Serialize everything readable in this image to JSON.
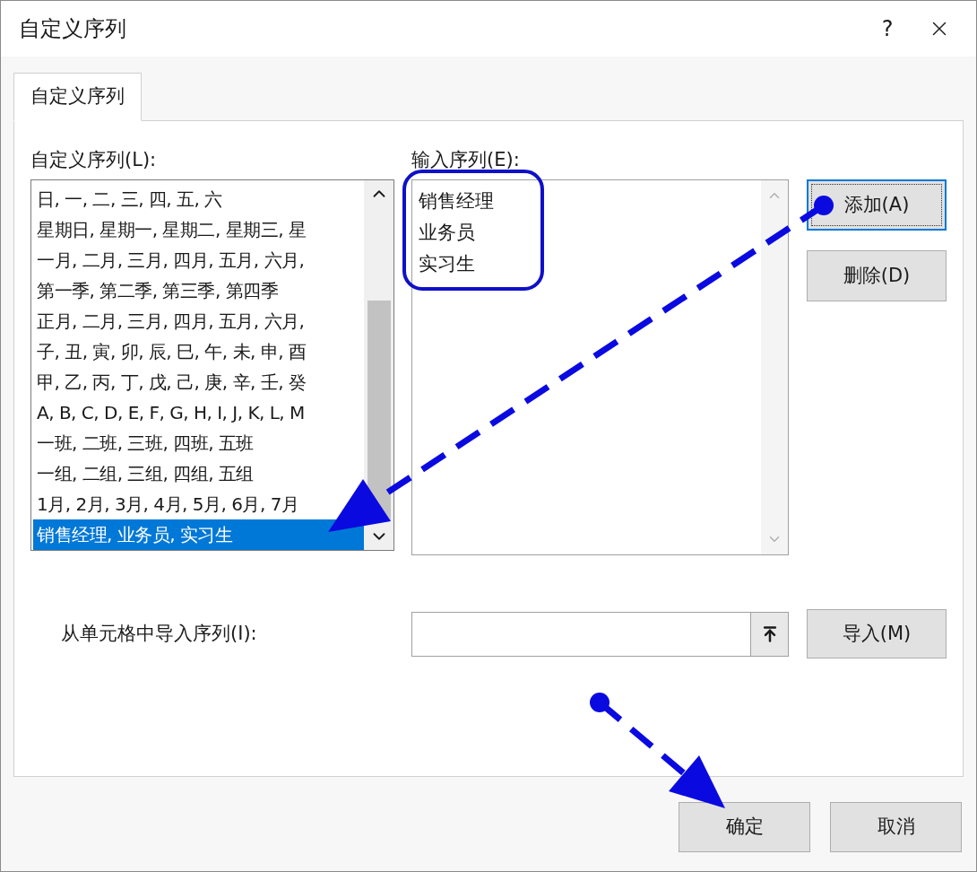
{
  "window": {
    "title": "自定义序列",
    "help": "?"
  },
  "tabs": [
    {
      "label": "自定义序列",
      "selected": true
    }
  ],
  "custom_lists": {
    "label": "自定义序列(L):",
    "items": [
      {
        "text": "日, 一, 二, 三, 四, 五, 六",
        "selected": false
      },
      {
        "text": "星期日, 星期一, 星期二, 星期三, 星",
        "selected": false
      },
      {
        "text": "一月, 二月, 三月, 四月, 五月, 六月,",
        "selected": false
      },
      {
        "text": "第一季, 第二季, 第三季, 第四季",
        "selected": false
      },
      {
        "text": "正月, 二月, 三月, 四月, 五月, 六月,",
        "selected": false
      },
      {
        "text": "子, 丑, 寅, 卯, 辰, 巳, 午, 未, 申, 酉",
        "selected": false
      },
      {
        "text": "甲, 乙, 丙, 丁, 戊, 己, 庚, 辛, 壬, 癸",
        "selected": false
      },
      {
        "text": "A, B, C, D, E, F, G, H, I, J, K, L, M",
        "selected": false
      },
      {
        "text": "一班, 二班, 三班, 四班, 五班",
        "selected": false
      },
      {
        "text": "一组, 二组, 三组, 四组, 五组",
        "selected": false
      },
      {
        "text": "1月, 2月, 3月, 4月, 5月, 6月, 7月",
        "selected": false
      },
      {
        "text": "销售经理, 业务员, 实习生",
        "selected": true
      }
    ]
  },
  "list_entries": {
    "label": "输入序列(E):",
    "lines": [
      "销售经理",
      "业务员",
      "实习生"
    ]
  },
  "side_buttons": [
    {
      "label": "添加(A)",
      "focused": true
    },
    {
      "label": "删除(D)",
      "focused": false
    }
  ],
  "import": {
    "label": "从单元格中导入序列(I):",
    "button": "导入(M)"
  },
  "footer_buttons": [
    "确定",
    "取消"
  ]
}
